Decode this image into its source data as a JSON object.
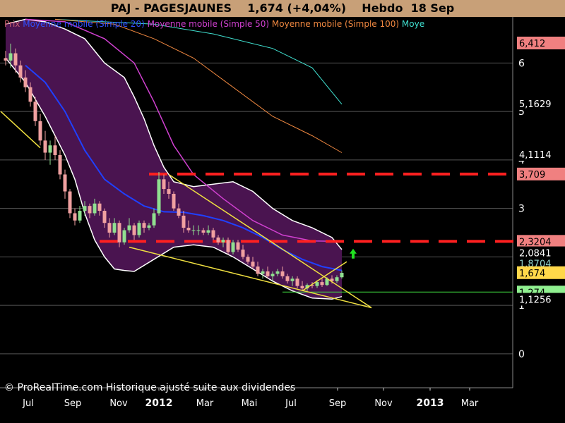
{
  "header": {
    "title": "PAJ - PAGESJAUNES",
    "price": "1,674 (+4,04%)",
    "period": "Hebdo",
    "date": "18 Sep"
  },
  "legend": {
    "items": [
      {
        "label": "Prix",
        "color": "#c86070"
      },
      {
        "label": "Moyenne mobile (Simple 20)",
        "color": "#3050ff"
      },
      {
        "label": "Moyenne mobile (Simple 50)",
        "color": "#d040d0"
      },
      {
        "label": "Moyenne mobile (Simple 100)",
        "color": "#f08840"
      },
      {
        "label": "Moye",
        "color": "#40e0d0"
      }
    ]
  },
  "footer": {
    "text": "© ProRealTime.com Historique ajusté suite aux dividendes"
  },
  "price_tags": [
    {
      "label": "6,412",
      "value": 6.412,
      "bg": "#f08080",
      "fg": "#000000"
    },
    {
      "label": "5,1629",
      "value": 5.1629,
      "bg": "#000000",
      "fg": "#ffffff"
    },
    {
      "label": "4,1114",
      "value": 4.1114,
      "bg": "#000000",
      "fg": "#ffffff"
    },
    {
      "label": "3,709",
      "value": 3.709,
      "bg": "#f08080",
      "fg": "#000000"
    },
    {
      "label": "2,3204",
      "value": 2.3204,
      "bg": "#f08080",
      "fg": "#000000"
    },
    {
      "label": "2,0841",
      "value": 2.0841,
      "bg": "#000000",
      "fg": "#ffffff"
    },
    {
      "label": "1,8704",
      "value": 1.8704,
      "bg": "#000000",
      "fg": "#8fd0c8"
    },
    {
      "label": "1,674",
      "value": 1.674,
      "bg": "#ffd84a",
      "fg": "#000000"
    },
    {
      "label": "1,274",
      "value": 1.274,
      "bg": "#90f090",
      "fg": "#000000"
    },
    {
      "label": "1,1256",
      "value": 1.1256,
      "bg": "#000000",
      "fg": "#ffffff"
    }
  ],
  "chart_data": {
    "type": "line",
    "instrument": "PAJ - PAGESJAUNES",
    "interval": "Hebdo",
    "y_ticks": [
      0,
      1,
      2,
      3,
      4,
      5,
      6
    ],
    "ylim": [
      -0.7,
      6.95
    ],
    "x_ticks": [
      {
        "label": "Jul",
        "bold": false
      },
      {
        "label": "Sep",
        "bold": false
      },
      {
        "label": "Nov",
        "bold": false
      },
      {
        "label": "2012",
        "bold": true
      },
      {
        "label": "Mar",
        "bold": false
      },
      {
        "label": "Mai",
        "bold": false
      },
      {
        "label": "Jul",
        "bold": false
      },
      {
        "label": "Sep",
        "bold": false
      },
      {
        "label": "Nov",
        "bold": false
      },
      {
        "label": "2013",
        "bold": true
      },
      {
        "label": "Mar",
        "bold": false
      }
    ],
    "colors": {
      "bollinger_fill": "#4a1450",
      "candle_up": "#90e090",
      "candle_down": "#f0a0a0",
      "sma20": "#2040ff",
      "sma50": "#d040d0",
      "sma100": "#f08840",
      "sma200": "#40e0d0",
      "trendline": "#f0e040",
      "resistance": "#ff2020",
      "support": "#40e040",
      "arrow": "#20e020"
    },
    "candles": [
      [
        6.1,
        6.25,
        5.95,
        6.05
      ],
      [
        6.05,
        6.4,
        5.9,
        6.2
      ],
      [
        6.2,
        6.3,
        5.8,
        5.95
      ],
      [
        5.95,
        6.05,
        5.6,
        5.7
      ],
      [
        5.7,
        5.85,
        5.4,
        5.5
      ],
      [
        5.5,
        5.6,
        5.1,
        5.2
      ],
      [
        5.2,
        5.3,
        4.7,
        4.8
      ],
      [
        4.8,
        4.95,
        4.3,
        4.4
      ],
      [
        4.4,
        4.6,
        4.0,
        4.15
      ],
      [
        4.15,
        4.4,
        3.9,
        4.3
      ],
      [
        4.3,
        4.5,
        4.0,
        4.1
      ],
      [
        4.1,
        4.2,
        3.6,
        3.7
      ],
      [
        3.7,
        3.8,
        3.2,
        3.35
      ],
      [
        3.35,
        3.4,
        2.8,
        2.9
      ],
      [
        2.9,
        3.0,
        2.65,
        2.75
      ],
      [
        2.75,
        3.05,
        2.7,
        2.95
      ],
      [
        2.95,
        3.15,
        2.85,
        3.05
      ],
      [
        3.05,
        3.1,
        2.8,
        2.9
      ],
      [
        2.9,
        3.2,
        2.85,
        3.1
      ],
      [
        3.1,
        3.15,
        2.85,
        2.95
      ],
      [
        2.95,
        3.0,
        2.6,
        2.7
      ],
      [
        2.7,
        2.8,
        2.4,
        2.5
      ],
      [
        2.5,
        2.8,
        2.45,
        2.7
      ],
      [
        2.7,
        2.75,
        2.2,
        2.3
      ],
      [
        2.3,
        2.6,
        2.25,
        2.55
      ],
      [
        2.55,
        2.8,
        2.5,
        2.65
      ],
      [
        2.65,
        2.7,
        2.35,
        2.45
      ],
      [
        2.45,
        2.75,
        2.4,
        2.7
      ],
      [
        2.7,
        2.75,
        2.5,
        2.6
      ],
      [
        2.6,
        2.7,
        2.55,
        2.65
      ],
      [
        2.65,
        3.0,
        2.6,
        2.9
      ],
      [
        2.9,
        3.75,
        2.85,
        3.6
      ],
      [
        3.6,
        3.7,
        3.3,
        3.4
      ],
      [
        3.4,
        3.55,
        3.2,
        3.3
      ],
      [
        3.3,
        3.35,
        2.95,
        3.0
      ],
      [
        3.0,
        3.1,
        2.8,
        2.85
      ],
      [
        2.85,
        2.95,
        2.5,
        2.6
      ],
      [
        2.6,
        2.75,
        2.5,
        2.55
      ],
      [
        2.55,
        2.65,
        2.45,
        2.55
      ],
      [
        2.55,
        2.65,
        2.45,
        2.55
      ],
      [
        2.55,
        2.6,
        2.45,
        2.5
      ],
      [
        2.5,
        2.65,
        2.45,
        2.55
      ],
      [
        2.55,
        2.6,
        2.35,
        2.4
      ],
      [
        2.4,
        2.45,
        2.25,
        2.3
      ],
      [
        2.3,
        2.4,
        2.2,
        2.35
      ],
      [
        2.35,
        2.4,
        2.05,
        2.1
      ],
      [
        2.1,
        2.35,
        2.05,
        2.3
      ],
      [
        2.3,
        2.35,
        2.1,
        2.15
      ],
      [
        2.15,
        2.25,
        1.95,
        2.0
      ],
      [
        2.0,
        2.05,
        1.85,
        1.9
      ],
      [
        1.9,
        2.0,
        1.75,
        1.8
      ],
      [
        1.8,
        1.9,
        1.6,
        1.65
      ],
      [
        1.65,
        1.75,
        1.55,
        1.7
      ],
      [
        1.7,
        1.8,
        1.55,
        1.6
      ],
      [
        1.6,
        1.7,
        1.5,
        1.65
      ],
      [
        1.65,
        1.75,
        1.6,
        1.7
      ],
      [
        1.7,
        1.8,
        1.55,
        1.6
      ],
      [
        1.6,
        1.65,
        1.45,
        1.5
      ],
      [
        1.5,
        1.6,
        1.4,
        1.55
      ],
      [
        1.55,
        1.6,
        1.35,
        1.4
      ],
      [
        1.4,
        1.5,
        1.3,
        1.35
      ],
      [
        1.35,
        1.45,
        1.3,
        1.42
      ],
      [
        1.42,
        1.48,
        1.35,
        1.4
      ],
      [
        1.4,
        1.52,
        1.36,
        1.48
      ],
      [
        1.48,
        1.55,
        1.38,
        1.42
      ],
      [
        1.42,
        1.58,
        1.4,
        1.55
      ],
      [
        1.55,
        1.62,
        1.45,
        1.5
      ],
      [
        1.5,
        1.62,
        1.46,
        1.58
      ],
      [
        1.58,
        1.72,
        1.55,
        1.67
      ]
    ],
    "ma20": [
      [
        4,
        5.95
      ],
      [
        8,
        5.6
      ],
      [
        12,
        5.0
      ],
      [
        16,
        4.2
      ],
      [
        20,
        3.6
      ],
      [
        24,
        3.3
      ],
      [
        28,
        3.05
      ],
      [
        32,
        2.93
      ],
      [
        36,
        2.92
      ],
      [
        40,
        2.85
      ],
      [
        44,
        2.75
      ],
      [
        48,
        2.6
      ],
      [
        52,
        2.4
      ],
      [
        56,
        2.15
      ],
      [
        60,
        1.95
      ],
      [
        64,
        1.8
      ],
      [
        68,
        1.72
      ]
    ],
    "ma50": [
      [
        4,
        6.9
      ],
      [
        12,
        6.85
      ],
      [
        20,
        6.5
      ],
      [
        26,
        6.0
      ],
      [
        30,
        5.2
      ],
      [
        34,
        4.3
      ],
      [
        38,
        3.7
      ],
      [
        44,
        3.2
      ],
      [
        50,
        2.75
      ],
      [
        56,
        2.45
      ],
      [
        62,
        2.33
      ],
      [
        68,
        2.32
      ]
    ],
    "ma100": [
      [
        10,
        6.9
      ],
      [
        22,
        6.8
      ],
      [
        30,
        6.5
      ],
      [
        38,
        6.1
      ],
      [
        46,
        5.5
      ],
      [
        54,
        4.9
      ],
      [
        62,
        4.5
      ],
      [
        68,
        4.15
      ]
    ],
    "ma200": [
      [
        10,
        6.9
      ],
      [
        30,
        6.8
      ],
      [
        42,
        6.6
      ],
      [
        54,
        6.3
      ],
      [
        62,
        5.9
      ],
      [
        68,
        5.15
      ]
    ],
    "bb_upper": [
      [
        0,
        6.8
      ],
      [
        4,
        6.9
      ],
      [
        8,
        6.85
      ],
      [
        12,
        6.7
      ],
      [
        16,
        6.5
      ],
      [
        20,
        6.0
      ],
      [
        24,
        5.7
      ],
      [
        26,
        5.3
      ],
      [
        28,
        4.85
      ],
      [
        30,
        4.3
      ],
      [
        32,
        3.85
      ],
      [
        34,
        3.55
      ],
      [
        38,
        3.45
      ],
      [
        42,
        3.5
      ],
      [
        46,
        3.55
      ],
      [
        50,
        3.35
      ],
      [
        54,
        3.0
      ],
      [
        58,
        2.75
      ],
      [
        62,
        2.6
      ],
      [
        66,
        2.4
      ],
      [
        68,
        2.15
      ]
    ],
    "bb_lower": [
      [
        0,
        6.1
      ],
      [
        4,
        5.6
      ],
      [
        8,
        4.9
      ],
      [
        12,
        4.1
      ],
      [
        14,
        3.6
      ],
      [
        16,
        2.9
      ],
      [
        18,
        2.35
      ],
      [
        20,
        2.0
      ],
      [
        22,
        1.75
      ],
      [
        24,
        1.72
      ],
      [
        26,
        1.7
      ],
      [
        30,
        1.95
      ],
      [
        34,
        2.2
      ],
      [
        38,
        2.25
      ],
      [
        42,
        2.2
      ],
      [
        46,
        2.0
      ],
      [
        50,
        1.75
      ],
      [
        54,
        1.5
      ],
      [
        58,
        1.3
      ],
      [
        62,
        1.15
      ],
      [
        66,
        1.13
      ],
      [
        68,
        1.18
      ]
    ],
    "trendlines": [
      [
        [
          -1,
          5.0
        ],
        [
          7,
          4.25
        ]
      ],
      [
        [
          25,
          2.2
        ],
        [
          74,
          0.95
        ]
      ],
      [
        [
          33,
          3.7
        ],
        [
          74,
          0.95
        ]
      ],
      [
        [
          60,
          1.3
        ],
        [
          69,
          1.9
        ]
      ]
    ],
    "resistance_levels": [
      3.709,
      2.3204
    ],
    "support_level": 1.274,
    "last_close": 1.674
  }
}
